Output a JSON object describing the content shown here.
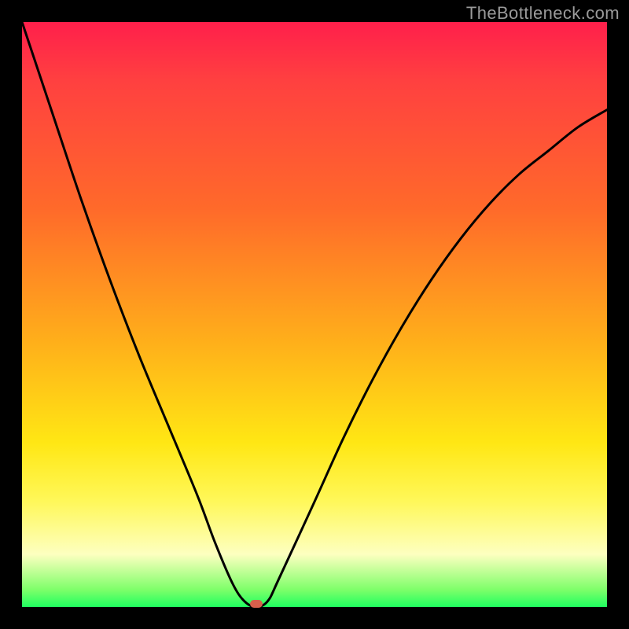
{
  "watermark": {
    "text": "TheBottleneck.com"
  },
  "chart_data": {
    "type": "line",
    "title": "",
    "xlabel": "",
    "ylabel": "",
    "xlim": [
      0,
      100
    ],
    "ylim": [
      0,
      100
    ],
    "grid": false,
    "legend": false,
    "series": [
      {
        "name": "bottleneck-curve",
        "x": [
          0,
          5,
          10,
          15,
          20,
          25,
          30,
          33,
          36,
          38,
          40,
          42,
          44,
          50,
          55,
          60,
          65,
          70,
          75,
          80,
          85,
          90,
          95,
          100
        ],
        "y": [
          100,
          85,
          70,
          56,
          43,
          31,
          19,
          11,
          4,
          1,
          0,
          1,
          5,
          18,
          29,
          39,
          48,
          56,
          63,
          69,
          74,
          78,
          82,
          85
        ]
      }
    ],
    "markers": [
      {
        "name": "minimum-point",
        "x": 40,
        "y": 0.5,
        "color": "#d8604c"
      }
    ],
    "background_gradient": {
      "direction": "top-to-bottom",
      "stops": [
        {
          "pos": 0.0,
          "color": "#ff1f4b"
        },
        {
          "pos": 0.1,
          "color": "#ff4040"
        },
        {
          "pos": 0.32,
          "color": "#ff6a2a"
        },
        {
          "pos": 0.55,
          "color": "#ffb01a"
        },
        {
          "pos": 0.72,
          "color": "#ffe714"
        },
        {
          "pos": 0.82,
          "color": "#fff85a"
        },
        {
          "pos": 0.91,
          "color": "#fdffc0"
        },
        {
          "pos": 0.97,
          "color": "#7fff6a"
        },
        {
          "pos": 1.0,
          "color": "#1fff60"
        }
      ]
    }
  }
}
